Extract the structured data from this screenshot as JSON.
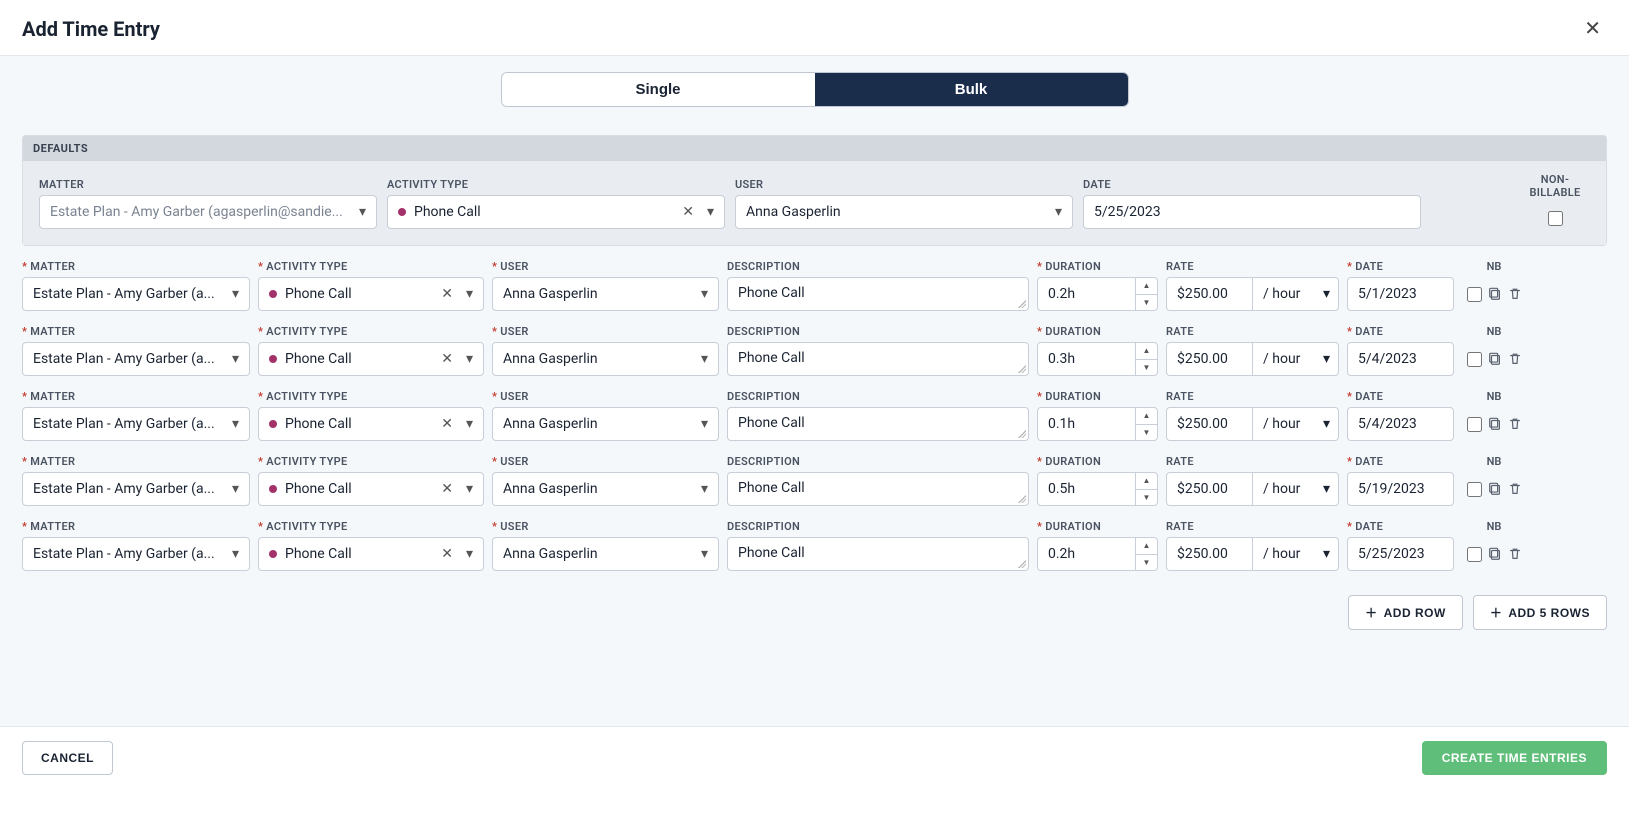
{
  "title": "Add Time Entry",
  "tabs": {
    "single": "Single",
    "bulk": "Bulk",
    "active": "bulk"
  },
  "defaults": {
    "section_label": "DEFAULTS",
    "labels": {
      "matter": "MATTER",
      "activity_type": "ACTIVITY TYPE",
      "user": "USER",
      "date": "DATE",
      "non_billable": "NON-BILLABLE"
    },
    "matter": "Estate Plan - Amy Garber (agasperlin@sandie...",
    "activity_type": "Phone Call",
    "user": "Anna Gasperlin",
    "date": "5/25/2023",
    "non_billable": false
  },
  "row_labels": {
    "matter": "MATTER",
    "activity_type": "ACTIVITY TYPE",
    "user": "USER",
    "description": "DESCRIPTION",
    "duration": "DURATION",
    "rate": "RATE",
    "date": "DATE",
    "nb": "NB"
  },
  "rate_unit_label": "/ hour",
  "rows": [
    {
      "matter": "Estate Plan - Amy Garber (a...",
      "activity_type": "Phone Call",
      "user": "Anna Gasperlin",
      "description": "Phone Call",
      "duration": "0.2h",
      "rate": "$250.00",
      "date": "5/1/2023",
      "nb": false
    },
    {
      "matter": "Estate Plan - Amy Garber (a...",
      "activity_type": "Phone Call",
      "user": "Anna Gasperlin",
      "description": "Phone Call",
      "duration": "0.3h",
      "rate": "$250.00",
      "date": "5/4/2023",
      "nb": false
    },
    {
      "matter": "Estate Plan - Amy Garber (a...",
      "activity_type": "Phone Call",
      "user": "Anna Gasperlin",
      "description": "Phone Call",
      "duration": "0.1h",
      "rate": "$250.00",
      "date": "5/4/2023",
      "nb": false
    },
    {
      "matter": "Estate Plan - Amy Garber (a...",
      "activity_type": "Phone Call",
      "user": "Anna Gasperlin",
      "description": "Phone Call",
      "duration": "0.5h",
      "rate": "$250.00",
      "date": "5/19/2023",
      "nb": false
    },
    {
      "matter": "Estate Plan - Amy Garber (a...",
      "activity_type": "Phone Call",
      "user": "Anna Gasperlin",
      "description": "Phone Call",
      "duration": "0.2h",
      "rate": "$250.00",
      "date": "5/25/2023",
      "nb": false
    }
  ],
  "buttons": {
    "add_row": "ADD ROW",
    "add_5_rows": "ADD 5 ROWS",
    "cancel": "CANCEL",
    "create": "CREATE TIME ENTRIES"
  }
}
